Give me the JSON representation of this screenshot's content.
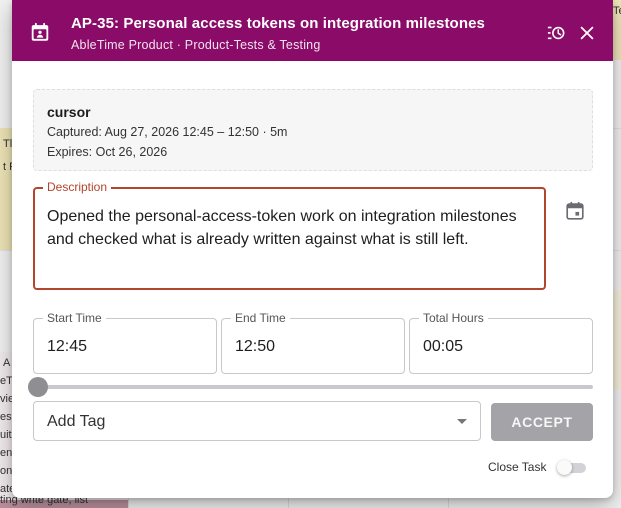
{
  "background": {
    "snippets": [
      "Tl",
      "t P",
      "Te",
      "A",
      "eTi",
      "viev",
      "est",
      "uits",
      "ens",
      "on",
      "ate",
      "ing",
      "ting write gate, list"
    ]
  },
  "dialog": {
    "title": "AP-35: Personal access tokens on integration milestones",
    "subtitle": "AbleTime Product · Product-Tests & Testing",
    "header_icon": "calendar-badge-icon",
    "history_icon": "history-clock-icon",
    "close_icon": "close-icon"
  },
  "capture": {
    "source": "cursor",
    "captured": "Captured: Aug 27, 2026 12:45 – 12:50 · 5m",
    "expires": "Expires: Oct 26, 2026"
  },
  "description": {
    "label": "Description",
    "value": "Opened the personal-access-token work on integration milestones and checked what is already written against what is still left."
  },
  "times": {
    "start_label": "Start Time",
    "start_value": "12:45",
    "end_label": "End Time",
    "end_value": "12:50",
    "total_label": "Total Hours",
    "total_value": "00:05"
  },
  "slider": {
    "value": 0
  },
  "tag": {
    "placeholder": "Add Tag"
  },
  "actions": {
    "accept_label": "ACCEPT",
    "close_task_label": "Close Task",
    "close_task_on": false
  },
  "colors": {
    "header": "#8a0b68",
    "description_border": "#b3452b",
    "accept_disabled": "#a3a3a8"
  }
}
